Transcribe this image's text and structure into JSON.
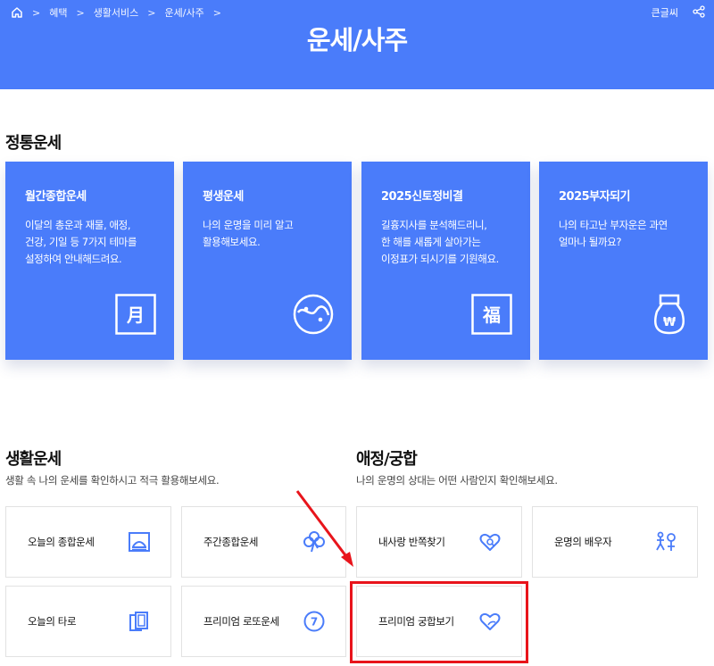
{
  "breadcrumb": {
    "items": [
      "혜택",
      "생활서비스",
      "운세/사주"
    ]
  },
  "header": {
    "title": "운세/사주",
    "bigtext_label": "큰글씨",
    "share_icon": "share-icon"
  },
  "traditional": {
    "title": "정통운세",
    "cards": [
      {
        "title": "월간종합운세",
        "desc": [
          "이달의 총운과 재물, 애정,",
          "건강, 기일 등 7가지 테마를",
          "설정하여 안내해드려요."
        ],
        "icon": "月"
      },
      {
        "title": "평생운세",
        "desc": [
          "나의 운명을 미리 알고",
          "활용해보세요."
        ],
        "icon": "yin-yang-icon"
      },
      {
        "title": "2025신토정비결",
        "desc": [
          "길흉지사를 분석해드리니,",
          "한 해를 새롭게 살아가는",
          "이정표가 되시기를 기원해요."
        ],
        "icon": "福"
      },
      {
        "title": "2025부자되기",
        "desc": [
          "나의 타고난 부자운은 과연",
          "얼마나 될까요?"
        ],
        "icon": "money-bag-icon"
      }
    ]
  },
  "life": {
    "title": "생활운세",
    "desc": "생활 속 나의 운세를 확인하시고 적극 활용해보세요.",
    "items": [
      {
        "label": "오늘의 종합운세",
        "icon": "sunrise-icon"
      },
      {
        "label": "주간종합운세",
        "icon": "clover-icon"
      },
      {
        "label": "오늘의 타로",
        "icon": "tarot-cards-icon"
      },
      {
        "label": "프리미엄 로또운세",
        "icon": "lotto-ball-icon",
        "badge": "7"
      }
    ]
  },
  "love": {
    "title": "애정/궁합",
    "desc": "나의 운명의 상대는 어떤 사람인지 확인해보세요.",
    "items": [
      {
        "label": "내사랑 반쪽찾기",
        "icon": "heart-search-icon"
      },
      {
        "label": "운명의 배우자",
        "icon": "couple-icon"
      },
      {
        "label": "프리미엄 궁합보기",
        "icon": "heart-outline-icon"
      }
    ]
  },
  "colors": {
    "brand": "#4a7cfa",
    "highlight": "#e8141b"
  }
}
